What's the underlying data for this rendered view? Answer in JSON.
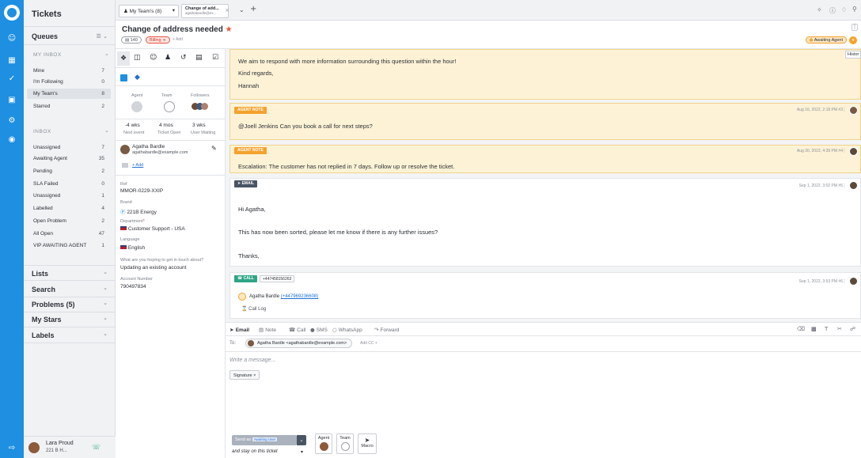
{
  "nav": {
    "title": "Tickets",
    "queues_label": "Queues",
    "my_inbox_header": "MY INBOX",
    "my_inbox": [
      {
        "label": "Mine",
        "count": "7"
      },
      {
        "label": "I'm Following",
        "count": "0"
      },
      {
        "label": "My Team's",
        "count": "8"
      },
      {
        "label": "Starred",
        "count": "2"
      }
    ],
    "inbox_header": "INBOX",
    "inbox": [
      {
        "label": "Unassigned",
        "count": "7"
      },
      {
        "label": "Awaiting Agent",
        "count": "35"
      },
      {
        "label": "Pending",
        "count": "2"
      },
      {
        "label": "SLA Failed",
        "count": "0"
      },
      {
        "label": "Unassigned",
        "count": "1"
      },
      {
        "label": "Labelled",
        "count": "4"
      },
      {
        "label": "Open Problem",
        "count": "2"
      },
      {
        "label": "All Open",
        "count": "47"
      },
      {
        "label": "VIP AWAITING AGENT",
        "count": "1"
      }
    ],
    "sections": [
      "Lists",
      "Search",
      "Problems (5)",
      "My Stars",
      "Labels"
    ],
    "user_name": "Lara Proud",
    "user_sub": "221 B H..."
  },
  "tabs": {
    "team_tab": "My Team's (8)",
    "ticket_tab_title": "Change of add...",
    "ticket_tab_sub": "agathabardle@ex..."
  },
  "ticket": {
    "title": "Change of address needed",
    "id_badge": "140",
    "label_badge": "Billing",
    "add_label": "+ Add",
    "status": "Awaiting Agent",
    "history_tooltip": "Histor"
  },
  "detail": {
    "agent_label": "Agent",
    "team_label": "Team",
    "followers_label": "Followers",
    "stats": [
      {
        "value": "-4 wks",
        "label": "Next event"
      },
      {
        "value": "4 mos",
        "label": "Ticket Open"
      },
      {
        "value": "3 wks",
        "label": "User Waiting"
      }
    ],
    "user_name": "Agatha Bardle",
    "user_email": "agathabardle@example.com",
    "add_link": "+ Add",
    "ref_label": "Ref",
    "ref_value": "MMOR-0229-XXIP",
    "brand_label": "Brand",
    "brand_value": "221B Energy",
    "department_label": "Department",
    "department_value": "Customer Support - USA",
    "language_label": "Language",
    "language_value": "English",
    "question_label": "What are you hoping to get in touch about?",
    "question_value": "Updating an existing account",
    "account_label": "Account Number",
    "account_value": "790497834"
  },
  "messages": {
    "first_lines": [
      "We aim to respond with more information surrounding this question within the hour!",
      "Kind regards,",
      "Hannah"
    ],
    "note1_tag": "AGENT NOTE",
    "note1_meta": "Aug 16, 2022, 2:18 PM  #3",
    "note1_text": "@Joell Jenkins Can you book a call for next steps?",
    "note2_tag": "AGENT NOTE",
    "note2_meta": "Aug 30, 2022, 4:39 PM  #4",
    "note2_text": "Escalation: The customer has not replied in 7 days. Follow up or resolve the ticket.",
    "email_tag": "EMAIL",
    "email_meta": "Sep 1, 2022, 3:02 PM  #5",
    "email_lines": [
      "Hi Agatha,",
      "This has now been sorted, please let me know if there is any further issues?",
      "Thanks,"
    ],
    "call_tag": "CALL",
    "call_number": "+447458156263",
    "call_meta": "Sep 1, 2022, 3:53 PM  #6",
    "call_person": "Agatha Bardle",
    "call_person_number": "(+447969236608)",
    "call_log": "Call Log"
  },
  "compose": {
    "tabs": [
      "Email",
      "Note",
      "Call",
      "SMS",
      "WhatsApp",
      "Forward"
    ],
    "to_label": "To:",
    "to_value": "Agatha Bardle <agathabardle@example.com>",
    "add_cc": "Add CC +",
    "placeholder": "Write a message...",
    "signature_chip": "Signature ×",
    "send_as": "Send as",
    "send_status": "Awaiting User",
    "stay_label": "and stay on this ticket",
    "agent_btn": "Agent",
    "team_btn": "Team",
    "macro_btn": "Macro"
  },
  "colors": {
    "brand": "#1e8fe1",
    "note_bg": "#fdf2d6",
    "note_tag": "#f4a22d",
    "email_tag": "#4a5563",
    "call_tag": "#2fa586",
    "status": "#f4a22d"
  }
}
